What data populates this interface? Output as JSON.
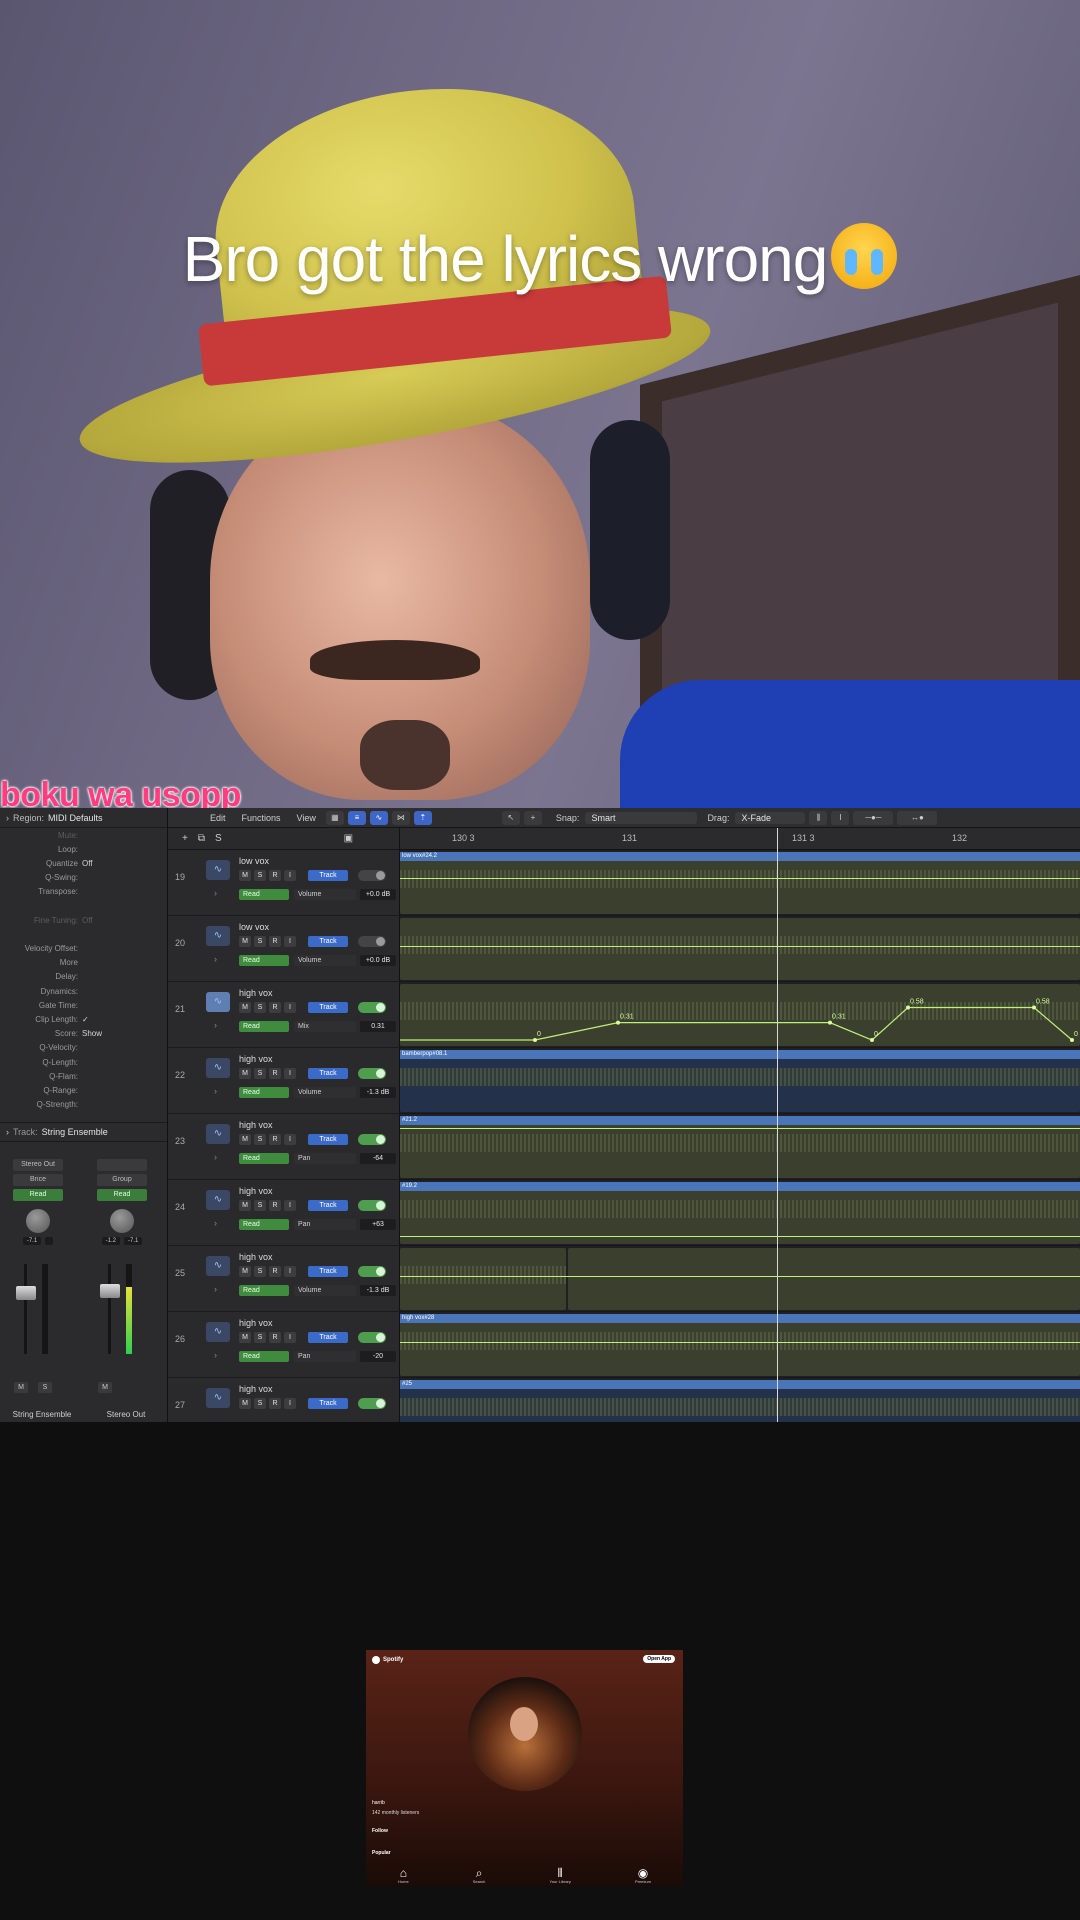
{
  "video": {
    "caption": "Bro got the lyrics wrong",
    "emoji": "loudly-crying-face-emoji",
    "lyric": "boku wa usopp"
  },
  "daw": {
    "inspector": {
      "region_label": "Region:",
      "region_name": "MIDI Defaults",
      "rows": [
        {
          "k": "Mute:",
          "v": "",
          "dim": true
        },
        {
          "k": "Loop:",
          "v": "",
          "dim": false
        },
        {
          "k": "Quantize",
          "v": "Off",
          "dim": false
        },
        {
          "k": "Q-Swing:",
          "v": "",
          "dim": false
        },
        {
          "k": "Transpose:",
          "v": "",
          "dim": false
        },
        {
          "k": "",
          "v": "",
          "dim": false
        },
        {
          "k": "Fine Tuning:",
          "v": "Off",
          "dim": true
        },
        {
          "k": "",
          "v": "",
          "dim": false
        },
        {
          "k": "Velocity Offset:",
          "v": "",
          "dim": false
        },
        {
          "k": "More",
          "v": "",
          "dim": false
        },
        {
          "k": "Delay:",
          "v": "",
          "dim": false
        },
        {
          "k": "Dynamics:",
          "v": "",
          "dim": false
        },
        {
          "k": "Gate Time:",
          "v": "",
          "dim": false
        },
        {
          "k": "Clip Length:",
          "v": "✓",
          "dim": false
        },
        {
          "k": "Score:",
          "v": "Show",
          "dim": false
        },
        {
          "k": "Q-Velocity:",
          "v": "",
          "dim": false
        },
        {
          "k": "Q-Length:",
          "v": "",
          "dim": false
        },
        {
          "k": "Q-Flam:",
          "v": "",
          "dim": false
        },
        {
          "k": "Q-Range:",
          "v": "",
          "dim": false
        },
        {
          "k": "Q-Strength:",
          "v": "",
          "dim": false
        }
      ],
      "track_label": "Track:",
      "track_name": "String Ensemble",
      "strips": [
        {
          "top": "Stereo Out",
          "mid": "Bnce",
          "read": "Read",
          "vals": [
            "-7.1",
            ""
          ],
          "ms": [
            "M",
            "S"
          ],
          "name": "String Ensemble",
          "meter": 0
        },
        {
          "top": "",
          "mid": "Group",
          "read": "Read",
          "vals": [
            "-1.2",
            "-7.1"
          ],
          "ms": [
            "M"
          ],
          "name": "Stereo Out",
          "meter": 0.75
        }
      ]
    },
    "toolbar": {
      "edit": "Edit",
      "functions": "Functions",
      "view": "View",
      "snap_label": "Snap:",
      "snap_value": "Smart",
      "drag_label": "Drag:",
      "drag_value": "X-Fade"
    },
    "ruler": [
      "130 3",
      "131",
      "131 3",
      "132"
    ],
    "tracks": [
      {
        "num": "19",
        "name": "low vox",
        "param": "Volume",
        "value": "+0.0 dB",
        "selected": false
      },
      {
        "num": "20",
        "name": "low vox",
        "param": "Volume",
        "value": "+0.0 dB",
        "selected": false
      },
      {
        "num": "21",
        "name": "high vox",
        "param": "Mix",
        "value": "0.31",
        "selected": true
      },
      {
        "num": "22",
        "name": "high vox",
        "param": "Volume",
        "value": "-1.3 dB",
        "selected": false
      },
      {
        "num": "23",
        "name": "high vox",
        "param": "Pan",
        "value": "-64",
        "selected": false
      },
      {
        "num": "24",
        "name": "high vox",
        "param": "Pan",
        "value": "+63",
        "selected": false
      },
      {
        "num": "25",
        "name": "high vox",
        "param": "Volume",
        "value": "-1.3 dB",
        "selected": false
      },
      {
        "num": "26",
        "name": "high vox",
        "param": "Pan",
        "value": "-20",
        "selected": false
      },
      {
        "num": "27",
        "name": "high vox",
        "param": "",
        "value": "",
        "selected": false
      }
    ],
    "track_buttons": {
      "m": "M",
      "s": "S",
      "r": "R",
      "i": "I",
      "track": "Track",
      "read": "Read"
    },
    "region_titles": {
      "low_vox": "low vox#24.2",
      "bamber": "bamberpop#08.1",
      "r23": "#21.2",
      "r24": "#19.2",
      "r26": "high vox#28",
      "r27": "#25"
    },
    "automation_points": [
      "0",
      "0.31",
      "0.31",
      "0",
      "0.58",
      "0.58",
      "0"
    ]
  },
  "spotify": {
    "brand": "Spotify",
    "open_app": "Open App",
    "artist": "harrib",
    "listeners": "142 monthly listeners",
    "follow": "Follow",
    "popular": "Popular",
    "nav": [
      {
        "icon": "home-icon",
        "glyph": "⌂",
        "label": "Home"
      },
      {
        "icon": "search-icon",
        "glyph": "⌕",
        "label": "Search"
      },
      {
        "icon": "library-icon",
        "glyph": "⫴",
        "label": "Your Library"
      },
      {
        "icon": "spotify-icon",
        "glyph": "◉",
        "label": "Premium"
      }
    ]
  }
}
